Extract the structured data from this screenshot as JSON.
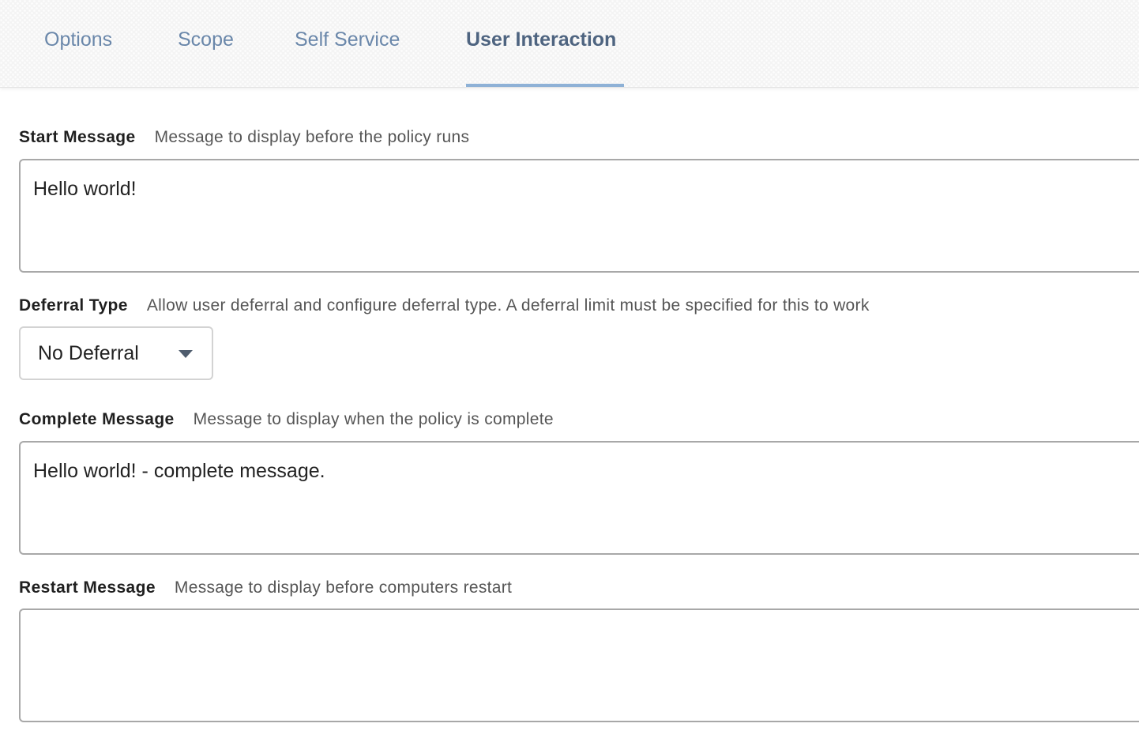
{
  "tabs": [
    {
      "label": "Options",
      "active": false
    },
    {
      "label": "Scope",
      "active": false
    },
    {
      "label": "Self Service",
      "active": false
    },
    {
      "label": "User Interaction",
      "active": true
    }
  ],
  "start_message": {
    "label": "Start Message",
    "description": "Message to display before the policy runs",
    "value": "Hello world!"
  },
  "deferral_type": {
    "label": "Deferral Type",
    "description": "Allow user deferral and configure deferral type. A deferral limit must be specified for this to work",
    "selected": "No Deferral"
  },
  "complete_message": {
    "label": "Complete Message",
    "description": "Message to display when the policy is complete",
    "value": "Hello world! - complete message."
  },
  "restart_message": {
    "label": "Restart Message",
    "description": "Message to display before computers restart",
    "value": ""
  },
  "colors": {
    "tab_text": "#6a87aa",
    "tab_active_text": "#4e6480",
    "tab_active_underline": "#8eb1d6"
  },
  "icons": {
    "dropdown": "caret-down-icon"
  }
}
